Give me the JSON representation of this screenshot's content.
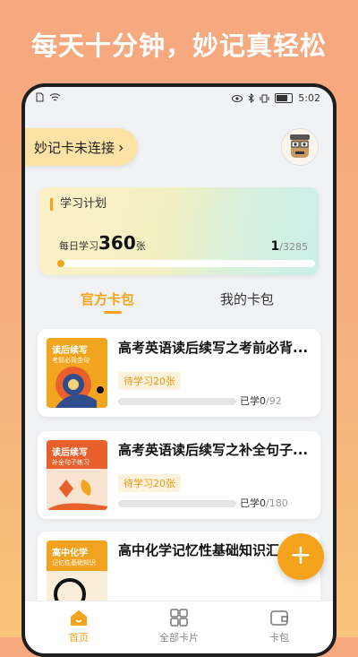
{
  "headline": "每天十分钟，妙记真轻松",
  "status_bar": {
    "time": "5:02"
  },
  "connect": {
    "label": "妙记卡未连接",
    "chevron": "›"
  },
  "plan": {
    "title": "学习计划",
    "daily_prefix": "每日学习",
    "daily_count": "360",
    "daily_unit": "张",
    "progress_current": "1",
    "progress_total": "/3285",
    "progress_fraction": 0.0003
  },
  "tabs": [
    {
      "label": "官方卡包",
      "active": true
    },
    {
      "label": "我的卡包",
      "active": false
    }
  ],
  "cards": [
    {
      "title": "高考英语读后续写之考前必背...",
      "cover_label": "读后续写",
      "cover_sub": "考前必背金句",
      "badge": "待学习20张",
      "learned_prefix": "已学",
      "learned": "0",
      "total": "/92",
      "cover_color": "#f2a51f"
    },
    {
      "title": "高考英语读后续写之补全句子...",
      "cover_label": "读后续写",
      "cover_sub": "补全句子练习",
      "badge": "待学习20张",
      "learned_prefix": "已学",
      "learned": "0",
      "total": "/180",
      "cover_color": "#e8602b"
    },
    {
      "title": "高中化学记忆性基础知识汇",
      "cover_label": "高中化学",
      "cover_sub": "记忆性基础知识",
      "cover_color": "#f1a320"
    }
  ],
  "fab": {
    "label": "+"
  },
  "nav": [
    {
      "label": "首页",
      "icon": "home-icon",
      "active": true
    },
    {
      "label": "全部卡片",
      "icon": "grid-icon",
      "active": false
    },
    {
      "label": "卡包",
      "icon": "wallet-icon",
      "active": false
    }
  ],
  "colors": {
    "accent": "#f4a31a",
    "background": "#f6a77e"
  }
}
